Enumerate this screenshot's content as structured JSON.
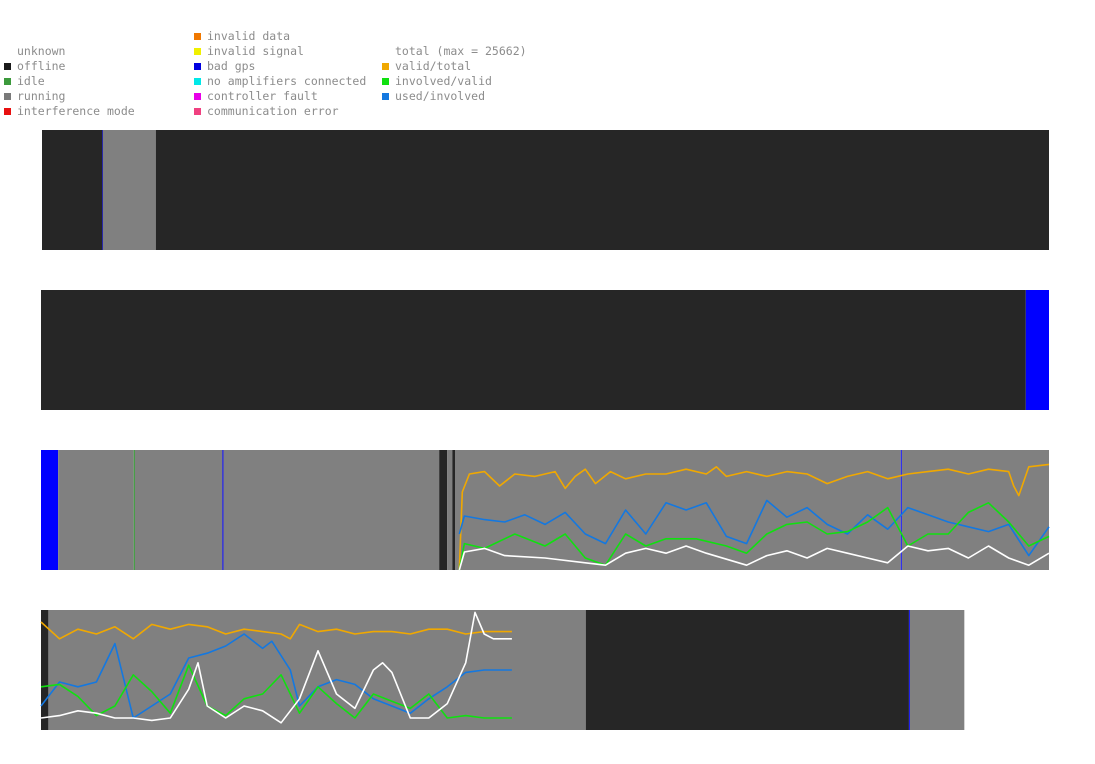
{
  "legend": {
    "status": [
      {
        "label": "unknown",
        "color": null
      },
      {
        "label": "offline",
        "color": "#1a1a1a"
      },
      {
        "label": "idle",
        "color": "#3c9a3c"
      },
      {
        "label": "running",
        "color": "#7a7a7a"
      },
      {
        "label": "interference mode",
        "color": "#e81010"
      }
    ],
    "errors": [
      {
        "label": "invalid data",
        "color": "#f07800"
      },
      {
        "label": "invalid signal",
        "color": "#f0f000"
      },
      {
        "label": "bad gps",
        "color": "#0000e0"
      },
      {
        "label": "no amplifiers connected",
        "color": "#00e8e8"
      },
      {
        "label": "controller fault",
        "color": "#e800e8"
      },
      {
        "label": "communication error",
        "color": "#f04080"
      }
    ],
    "ratios": [
      {
        "label": "total (max = 25662)",
        "color": null
      },
      {
        "label": "valid/total",
        "color": "#f0a800"
      },
      {
        "label": "involved/valid",
        "color": "#10e010"
      },
      {
        "label": "used/involved",
        "color": "#1478e0"
      }
    ]
  },
  "colors": {
    "offline": "#262626",
    "running": "#808080",
    "bad_gps": "#0000ff",
    "idle": "#3c9a3c",
    "total": "#ffffff",
    "valid_total": "#f0a800",
    "involved_valid": "#10e010",
    "used_involved": "#1478e0"
  },
  "chart_data": [
    {
      "type": "area",
      "xlim": [
        0,
        1
      ],
      "ylim": [
        0,
        1
      ],
      "status_segments": [
        {
          "from": 0.0,
          "to": 0.06,
          "status": "offline"
        },
        {
          "from": 0.06,
          "to": 0.0605,
          "status": "bad_gps"
        },
        {
          "from": 0.0605,
          "to": 0.113,
          "status": "running"
        },
        {
          "from": 0.113,
          "to": 1.0,
          "status": "offline"
        }
      ],
      "series": []
    },
    {
      "type": "area",
      "xlim": [
        0,
        1
      ],
      "ylim": [
        0,
        1
      ],
      "status_segments": [
        {
          "from": 0.0,
          "to": 0.977,
          "status": "offline"
        },
        {
          "from": 0.977,
          "to": 1.0,
          "status": "bad_gps"
        }
      ],
      "series": []
    },
    {
      "type": "line",
      "xlim": [
        0,
        1
      ],
      "ylim": [
        0,
        1
      ],
      "status_segments": [
        {
          "from": 0.0,
          "to": 0.017,
          "status": "bad_gps"
        },
        {
          "from": 0.017,
          "to": 0.092,
          "status": "running"
        },
        {
          "from": 0.092,
          "to": 0.0932,
          "status": "idle"
        },
        {
          "from": 0.0932,
          "to": 0.18,
          "status": "running"
        },
        {
          "from": 0.18,
          "to": 0.181,
          "status": "bad_gps"
        },
        {
          "from": 0.181,
          "to": 0.395,
          "status": "running"
        },
        {
          "from": 0.395,
          "to": 0.403,
          "status": "offline"
        },
        {
          "from": 0.403,
          "to": 0.408,
          "status": "running"
        },
        {
          "from": 0.408,
          "to": 0.411,
          "status": "offline"
        },
        {
          "from": 0.411,
          "to": 0.853,
          "status": "running"
        },
        {
          "from": 0.853,
          "to": 0.854,
          "status": "bad_gps"
        },
        {
          "from": 0.854,
          "to": 1.0,
          "status": "running"
        }
      ],
      "series": [
        {
          "key": "valid_total",
          "x": [
            0.415,
            0.418,
            0.425,
            0.44,
            0.455,
            0.47,
            0.49,
            0.51,
            0.52,
            0.53,
            0.54,
            0.55,
            0.565,
            0.58,
            0.6,
            0.62,
            0.64,
            0.66,
            0.67,
            0.68,
            0.7,
            0.72,
            0.74,
            0.76,
            0.78,
            0.8,
            0.82,
            0.84,
            0.86,
            0.88,
            0.9,
            0.92,
            0.94,
            0.96,
            0.965,
            0.97,
            0.98,
            1.0
          ],
          "y": [
            0.0,
            0.65,
            0.8,
            0.82,
            0.7,
            0.8,
            0.78,
            0.82,
            0.68,
            0.78,
            0.84,
            0.72,
            0.82,
            0.76,
            0.8,
            0.8,
            0.84,
            0.8,
            0.86,
            0.78,
            0.82,
            0.78,
            0.82,
            0.8,
            0.72,
            0.78,
            0.82,
            0.76,
            0.8,
            0.82,
            0.84,
            0.8,
            0.84,
            0.82,
            0.7,
            0.62,
            0.86,
            0.88
          ]
        },
        {
          "key": "used_involved",
          "x": [
            0.415,
            0.42,
            0.44,
            0.46,
            0.48,
            0.5,
            0.52,
            0.54,
            0.56,
            0.58,
            0.6,
            0.62,
            0.64,
            0.66,
            0.68,
            0.7,
            0.72,
            0.74,
            0.76,
            0.78,
            0.8,
            0.82,
            0.84,
            0.86,
            0.88,
            0.9,
            0.92,
            0.94,
            0.96,
            0.98,
            1.0
          ],
          "y": [
            0.3,
            0.45,
            0.42,
            0.4,
            0.46,
            0.38,
            0.48,
            0.3,
            0.22,
            0.5,
            0.3,
            0.56,
            0.5,
            0.56,
            0.28,
            0.22,
            0.58,
            0.44,
            0.52,
            0.38,
            0.3,
            0.46,
            0.34,
            0.52,
            0.46,
            0.4,
            0.36,
            0.32,
            0.38,
            0.12,
            0.36
          ]
        },
        {
          "key": "involved_valid",
          "x": [
            0.415,
            0.42,
            0.44,
            0.47,
            0.5,
            0.52,
            0.54,
            0.56,
            0.58,
            0.6,
            0.62,
            0.65,
            0.68,
            0.7,
            0.72,
            0.74,
            0.76,
            0.78,
            0.8,
            0.82,
            0.84,
            0.86,
            0.88,
            0.9,
            0.92,
            0.94,
            0.96,
            0.98,
            1.0
          ],
          "y": [
            0.0,
            0.22,
            0.18,
            0.3,
            0.2,
            0.3,
            0.1,
            0.04,
            0.3,
            0.2,
            0.26,
            0.26,
            0.2,
            0.14,
            0.3,
            0.38,
            0.4,
            0.3,
            0.32,
            0.4,
            0.52,
            0.2,
            0.3,
            0.3,
            0.48,
            0.56,
            0.4,
            0.2,
            0.28
          ]
        },
        {
          "key": "total",
          "x": [
            0.415,
            0.42,
            0.44,
            0.46,
            0.5,
            0.54,
            0.56,
            0.58,
            0.6,
            0.62,
            0.64,
            0.66,
            0.7,
            0.72,
            0.74,
            0.76,
            0.78,
            0.8,
            0.82,
            0.84,
            0.86,
            0.88,
            0.9,
            0.92,
            0.94,
            0.96,
            0.98,
            1.0
          ],
          "y": [
            0.0,
            0.15,
            0.18,
            0.12,
            0.1,
            0.06,
            0.04,
            0.14,
            0.18,
            0.14,
            0.2,
            0.14,
            0.04,
            0.12,
            0.16,
            0.1,
            0.18,
            0.14,
            0.1,
            0.06,
            0.2,
            0.16,
            0.18,
            0.1,
            0.2,
            0.1,
            0.04,
            0.14
          ]
        }
      ]
    },
    {
      "type": "line",
      "xlim": [
        0,
        1
      ],
      "ylim": [
        0,
        1
      ],
      "width_fraction": 0.916,
      "status_segments": [
        {
          "from": 0.0,
          "to": 0.008,
          "status": "offline"
        },
        {
          "from": 0.008,
          "to": 0.59,
          "status": "running"
        },
        {
          "from": 0.59,
          "to": 0.94,
          "status": "offline"
        },
        {
          "from": 0.94,
          "to": 0.941,
          "status": "bad_gps"
        },
        {
          "from": 0.941,
          "to": 1.0,
          "status": "running"
        }
      ],
      "series": [
        {
          "key": "valid_total",
          "x": [
            0.0,
            0.02,
            0.04,
            0.06,
            0.08,
            0.1,
            0.12,
            0.14,
            0.16,
            0.18,
            0.2,
            0.22,
            0.24,
            0.26,
            0.27,
            0.28,
            0.3,
            0.32,
            0.34,
            0.36,
            0.38,
            0.4,
            0.42,
            0.44,
            0.46,
            0.48,
            0.5,
            0.51
          ],
          "y": [
            0.9,
            0.76,
            0.84,
            0.8,
            0.86,
            0.76,
            0.88,
            0.84,
            0.88,
            0.86,
            0.8,
            0.84,
            0.82,
            0.8,
            0.76,
            0.88,
            0.82,
            0.84,
            0.8,
            0.82,
            0.82,
            0.8,
            0.84,
            0.84,
            0.8,
            0.82,
            0.82,
            0.82
          ]
        },
        {
          "key": "used_involved",
          "x": [
            0.0,
            0.02,
            0.04,
            0.06,
            0.08,
            0.1,
            0.12,
            0.14,
            0.16,
            0.18,
            0.2,
            0.22,
            0.24,
            0.25,
            0.27,
            0.28,
            0.3,
            0.32,
            0.34,
            0.36,
            0.38,
            0.4,
            0.42,
            0.44,
            0.46,
            0.48,
            0.51
          ],
          "y": [
            0.2,
            0.4,
            0.36,
            0.4,
            0.72,
            0.1,
            0.2,
            0.3,
            0.6,
            0.64,
            0.7,
            0.8,
            0.68,
            0.74,
            0.5,
            0.2,
            0.36,
            0.42,
            0.38,
            0.26,
            0.2,
            0.14,
            0.26,
            0.36,
            0.48,
            0.5,
            0.5
          ]
        },
        {
          "key": "involved_valid",
          "x": [
            0.0,
            0.02,
            0.04,
            0.06,
            0.08,
            0.1,
            0.12,
            0.14,
            0.16,
            0.18,
            0.2,
            0.22,
            0.24,
            0.26,
            0.28,
            0.3,
            0.32,
            0.34,
            0.36,
            0.38,
            0.4,
            0.42,
            0.44,
            0.46,
            0.48,
            0.51
          ],
          "y": [
            0.36,
            0.38,
            0.28,
            0.12,
            0.2,
            0.46,
            0.32,
            0.14,
            0.54,
            0.2,
            0.12,
            0.26,
            0.3,
            0.46,
            0.14,
            0.36,
            0.22,
            0.1,
            0.3,
            0.24,
            0.18,
            0.3,
            0.1,
            0.12,
            0.1,
            0.1
          ]
        },
        {
          "key": "total",
          "x": [
            0.0,
            0.02,
            0.04,
            0.06,
            0.08,
            0.1,
            0.12,
            0.14,
            0.16,
            0.17,
            0.18,
            0.2,
            0.22,
            0.24,
            0.26,
            0.28,
            0.3,
            0.32,
            0.34,
            0.36,
            0.37,
            0.38,
            0.4,
            0.42,
            0.44,
            0.46,
            0.47,
            0.48,
            0.49,
            0.51
          ],
          "y": [
            0.1,
            0.12,
            0.16,
            0.14,
            0.1,
            0.1,
            0.08,
            0.1,
            0.34,
            0.56,
            0.2,
            0.1,
            0.2,
            0.16,
            0.06,
            0.26,
            0.66,
            0.3,
            0.18,
            0.5,
            0.56,
            0.48,
            0.1,
            0.1,
            0.22,
            0.56,
            0.98,
            0.8,
            0.76,
            0.76
          ]
        }
      ]
    }
  ]
}
